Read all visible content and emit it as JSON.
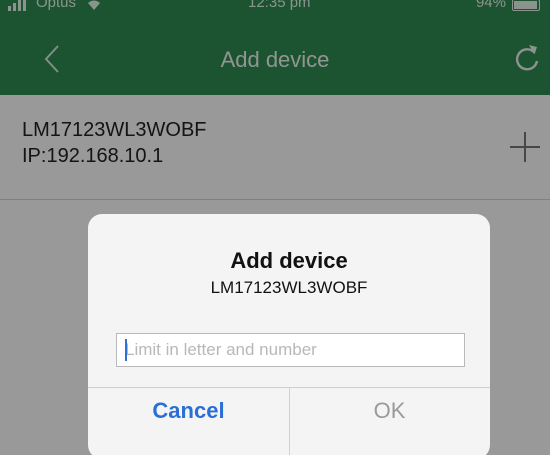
{
  "status_bar": {
    "carrier": "Optus",
    "time": "12:35 pm",
    "battery": "94%",
    "battery_level": 0.94
  },
  "nav": {
    "title": "Add device",
    "back_icon": "chevron-left-icon",
    "refresh_icon": "refresh-icon"
  },
  "device_list": [
    {
      "name": "LM17123WL3WOBF",
      "ip": "IP:192.168.10.1",
      "action_icon": "plus-icon"
    }
  ],
  "dialog": {
    "title": "Add device",
    "message": "LM17123WL3WOBF",
    "input_value": "",
    "input_placeholder": "Limit in letter and number",
    "cancel_label": "Cancel",
    "ok_label": "OK"
  },
  "colors": {
    "nav_green": "#2f8a53",
    "link_blue": "#2b6fd6",
    "disabled_gray": "#9a9a9a"
  }
}
